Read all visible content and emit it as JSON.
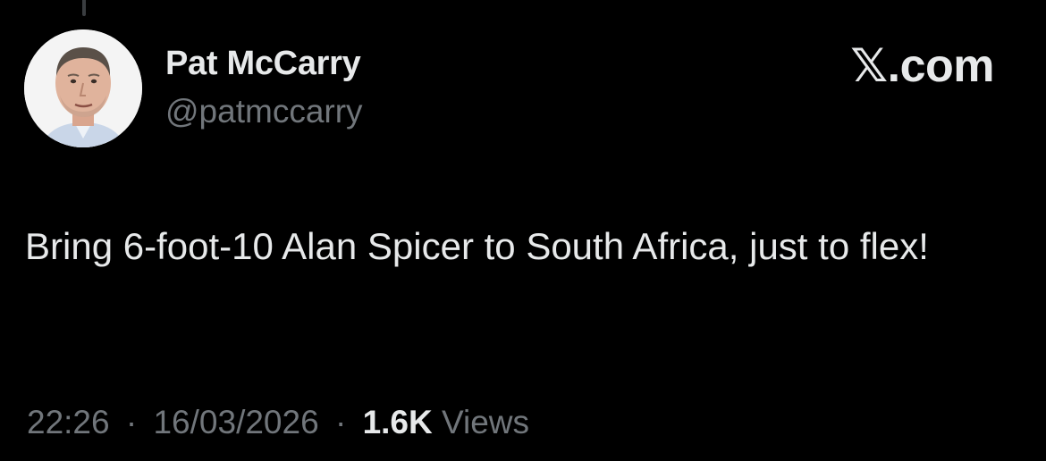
{
  "author": {
    "display_name": "Pat McCarry",
    "handle": "@patmccarry",
    "avatar_icon": "profile-photo-avatar"
  },
  "brand": {
    "label": "𝕏.com"
  },
  "tweet": {
    "text": "Bring 6-foot-10 Alan Spicer to South Africa, just to flex!"
  },
  "meta": {
    "time": "22:26",
    "separator": "·",
    "date": "16/03/2026",
    "views_count": "1.6K",
    "views_label": "Views"
  },
  "colors": {
    "background": "#000000",
    "primary_text": "#e7e9ea",
    "secondary_text": "#71767b"
  }
}
